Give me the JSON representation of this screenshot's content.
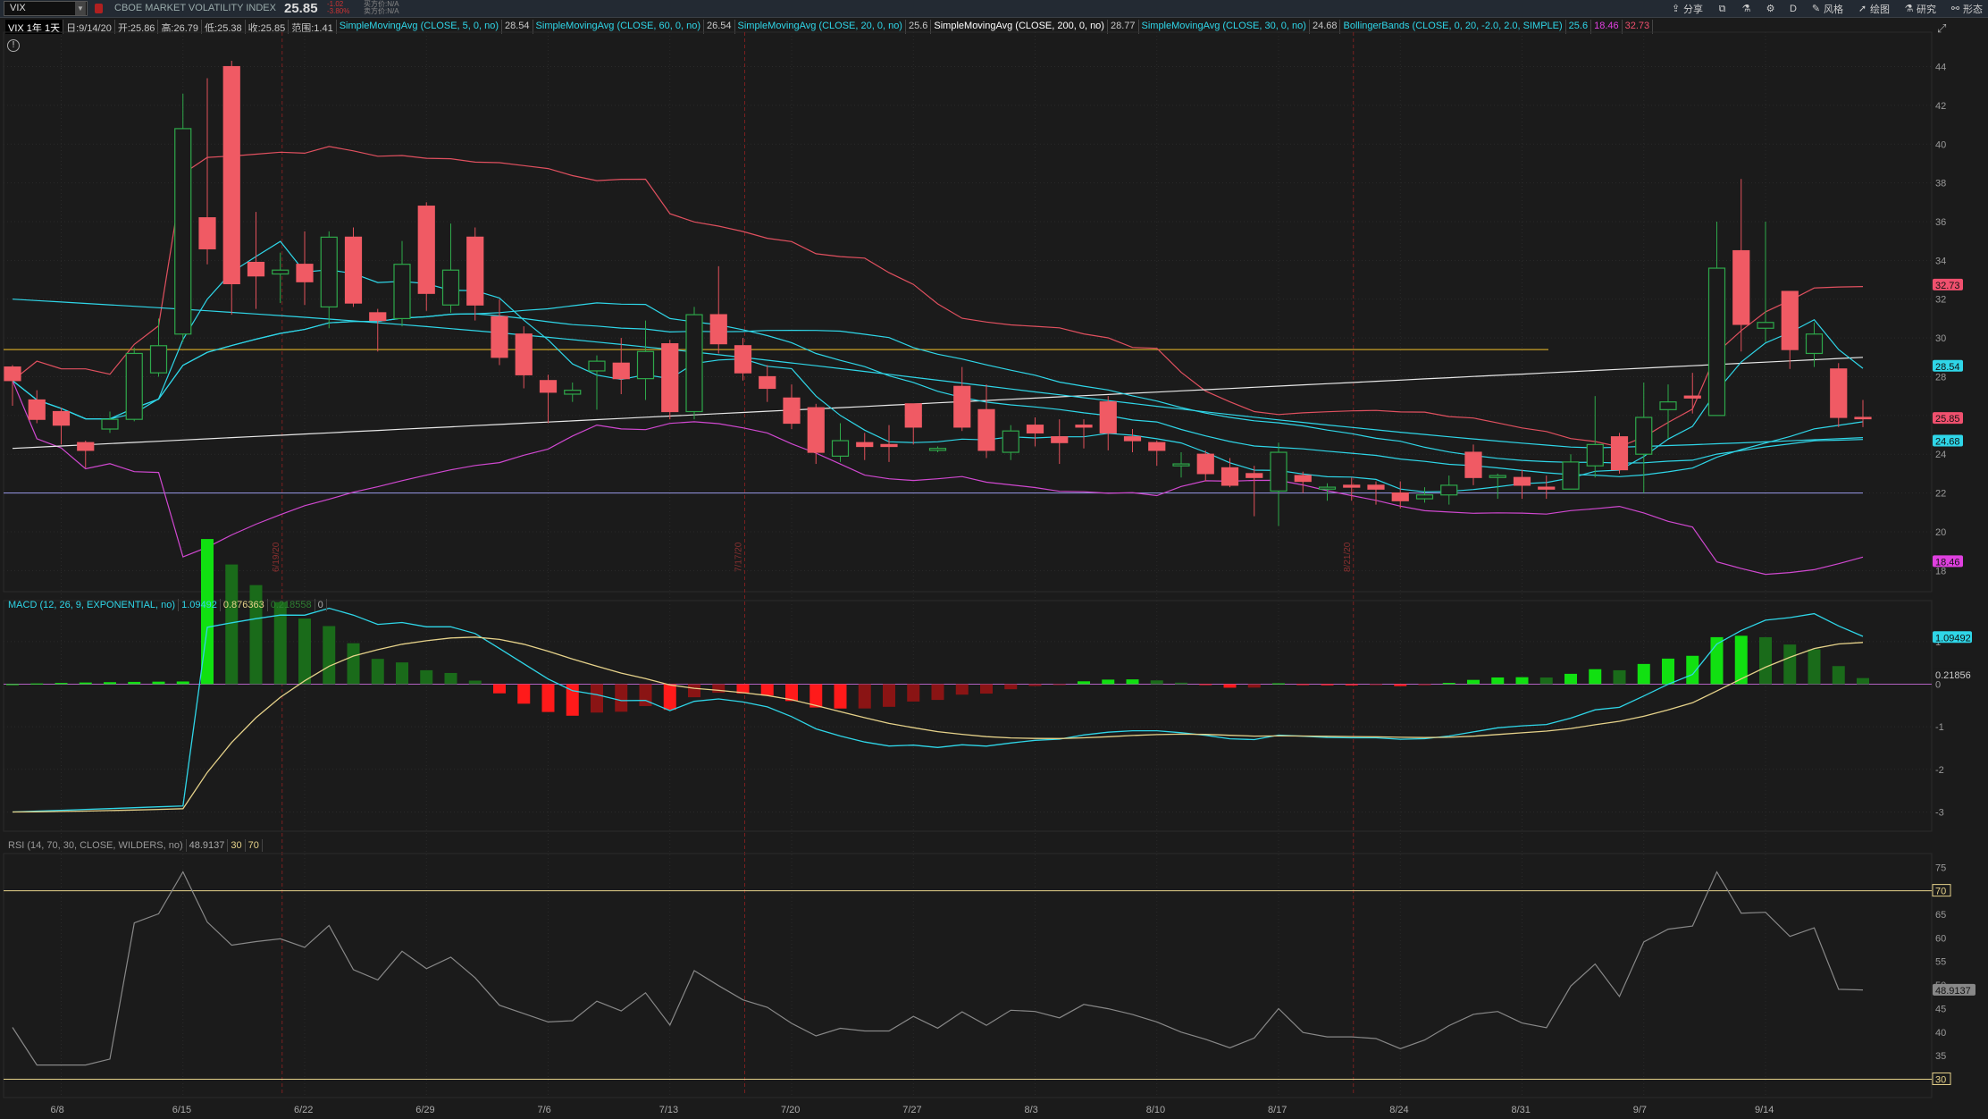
{
  "topbar": {
    "symbol": "VIX",
    "name": "CBOE MARKET VOLATILITY INDEX",
    "price": "25.85",
    "change": "-1.02",
    "change_pct": "-3.80%",
    "bid": "买方价:N/A",
    "ask": "卖方价:N/A",
    "tools": [
      {
        "label": "分享",
        "icon": "share-icon"
      },
      {
        "label": "",
        "icon": "compare-icon"
      },
      {
        "label": "",
        "icon": "flask-icon"
      },
      {
        "label": "",
        "icon": "gear-icon"
      },
      {
        "label": "D",
        "icon": ""
      },
      {
        "label": "风格",
        "icon": "style-icon"
      },
      {
        "label": "绘图",
        "icon": "cursor-icon"
      },
      {
        "label": "研究",
        "icon": "flask-icon"
      },
      {
        "label": "形态",
        "icon": "pattern-icon"
      }
    ]
  },
  "legend": {
    "title": "VIX 1年 1天",
    "date": "日:9/14/20",
    "open": "开:25.86",
    "high": "高:26.79",
    "low": "低:25.38",
    "close": "收:25.85",
    "range": "范围:1.41",
    "studies": [
      {
        "name": "SimpleMovingAvg (CLOSE, 5, 0, no)",
        "value": "28.54",
        "color": "#2fd6e8"
      },
      {
        "name": "SimpleMovingAvg (CLOSE, 60, 0, no)",
        "value": "26.54",
        "color": "#2fd6e8"
      },
      {
        "name": "SimpleMovingAvg (CLOSE, 20, 0, no)",
        "value": "25.6",
        "color": "#2fd6e8"
      },
      {
        "name": "SimpleMovingAvg (CLOSE, 200, 0, no)",
        "value": "28.77",
        "color": "#ffffff"
      },
      {
        "name": "SimpleMovingAvg (CLOSE, 30, 0, no)",
        "value": "24.68",
        "color": "#2fd6e8"
      },
      {
        "name": "BollingerBands (CLOSE, 0, 20, -2.0, 2.0, SIMPLE)",
        "value": "25.6",
        "value2": "18.46",
        "value3": "32.73",
        "color": "#2fd6e8"
      }
    ]
  },
  "price_panel": {
    "y_ticks": [
      "44",
      "42",
      "40",
      "38",
      "36",
      "34",
      "32",
      "30",
      "28",
      "26",
      "24",
      "22",
      "20",
      "18"
    ],
    "ylim": [
      17,
      45.5
    ],
    "badges": [
      {
        "value": "32.73",
        "color": "#f0506e"
      },
      {
        "value": "28.54",
        "color": "#2fd6e8"
      },
      {
        "value": "25.85",
        "color": "#f0506e"
      },
      {
        "value": "24.68",
        "color": "#2fd6e8"
      },
      {
        "value": "18.46",
        "color": "#e040e0"
      }
    ],
    "vlines": [
      "6/19/20",
      "7/17/20",
      "8/21/20"
    ]
  },
  "macd": {
    "legend": "MACD (12, 26, 9, EXPONENTIAL, no)",
    "value": "1.09492",
    "avg": "0.876363",
    "diff": "0.218558",
    "zero": "0",
    "y_ticks": [
      "1",
      "0",
      "-1",
      "-2",
      "-3"
    ],
    "badge_value": "1.09492",
    "badge_diff": "0.21856"
  },
  "rsi": {
    "legend": "RSI (14, 70, 30, CLOSE, WILDERS, no)",
    "value": "48.9137",
    "os": "30",
    "ob": "70",
    "y_ticks": [
      "75",
      "70",
      "65",
      "60",
      "55",
      "50",
      "45",
      "40",
      "35",
      "30"
    ],
    "badge_value": "48.9137"
  },
  "xaxis": [
    "6/8",
    "6/15",
    "6/22",
    "6/29",
    "7/6",
    "7/13",
    "7/20",
    "7/27",
    "8/3",
    "8/10",
    "8/17",
    "8/24",
    "8/31",
    "9/7",
    "9/14"
  ],
  "chart_data": {
    "type": "candlestick",
    "ohlc": [
      [
        28.5,
        27.8,
        26.5,
        28.6
      ],
      [
        26.8,
        25.8,
        25.6,
        27.3
      ],
      [
        26.2,
        25.5,
        24.5,
        26.4
      ],
      [
        24.6,
        24.2,
        23.3,
        24.7
      ],
      [
        25.3,
        25.8,
        25.1,
        26.2
      ],
      [
        25.8,
        29.2,
        25.7,
        29.5
      ],
      [
        28.2,
        29.6,
        28.0,
        31.0
      ],
      [
        30.2,
        40.8,
        29.8,
        42.6
      ],
      [
        36.2,
        34.6,
        33.8,
        43.4
      ],
      [
        44.0,
        32.8,
        31.2,
        44.3
      ],
      [
        33.9,
        33.2,
        31.5,
        36.5
      ],
      [
        33.3,
        33.5,
        31.8,
        34.4
      ],
      [
        33.8,
        32.9,
        31.7,
        35.5
      ],
      [
        31.6,
        35.2,
        30.5,
        35.5
      ],
      [
        35.2,
        31.8,
        31.6,
        35.7
      ],
      [
        31.3,
        30.9,
        29.3,
        31.5
      ],
      [
        31.0,
        33.8,
        30.6,
        35.0
      ],
      [
        36.8,
        32.3,
        31.4,
        37.0
      ],
      [
        31.7,
        33.5,
        31.3,
        35.9
      ],
      [
        35.2,
        31.7,
        30.9,
        35.7
      ],
      [
        31.1,
        29.0,
        28.6,
        32.0
      ],
      [
        30.2,
        28.1,
        27.4,
        30.6
      ],
      [
        27.8,
        27.2,
        25.6,
        28.1
      ],
      [
        27.1,
        27.3,
        26.7,
        27.7
      ],
      [
        28.3,
        28.8,
        26.3,
        29.1
      ],
      [
        28.7,
        27.9,
        27.1,
        30.0
      ],
      [
        27.9,
        29.3,
        26.8,
        30.9
      ],
      [
        29.7,
        26.2,
        25.8,
        29.9
      ],
      [
        26.2,
        31.2,
        25.8,
        31.6
      ],
      [
        31.2,
        29.7,
        29.2,
        33.7
      ],
      [
        29.6,
        28.2,
        27.8,
        30.0
      ],
      [
        28.0,
        27.4,
        26.7,
        28.6
      ],
      [
        26.9,
        25.6,
        25.3,
        27.6
      ],
      [
        26.4,
        24.1,
        23.5,
        26.6
      ],
      [
        23.9,
        24.7,
        23.6,
        25.6
      ],
      [
        24.6,
        24.4,
        23.7,
        25.1
      ],
      [
        24.5,
        24.4,
        23.6,
        25.5
      ],
      [
        26.6,
        25.4,
        24.5,
        26.6
      ],
      [
        24.2,
        24.3,
        24.1,
        24.4
      ],
      [
        27.5,
        25.4,
        25.2,
        28.5
      ],
      [
        26.3,
        24.2,
        23.8,
        27.6
      ],
      [
        24.1,
        25.2,
        23.7,
        25.5
      ],
      [
        25.5,
        25.1,
        24.4,
        25.9
      ],
      [
        24.9,
        24.6,
        23.5,
        25.8
      ],
      [
        25.5,
        25.4,
        24.3,
        25.8
      ],
      [
        26.7,
        25.1,
        24.2,
        27.0
      ],
      [
        24.9,
        24.7,
        24.1,
        25.3
      ],
      [
        24.6,
        24.2,
        23.4,
        24.7
      ],
      [
        23.4,
        23.5,
        22.8,
        24.1
      ],
      [
        24.0,
        23.0,
        22.6,
        24.2
      ],
      [
        23.3,
        22.4,
        22.3,
        23.8
      ],
      [
        23.0,
        22.8,
        20.8,
        23.4
      ],
      [
        22.1,
        24.1,
        20.3,
        24.6
      ],
      [
        22.9,
        22.6,
        22.0,
        23.1
      ],
      [
        22.2,
        22.3,
        21.6,
        22.5
      ],
      [
        22.4,
        22.3,
        21.6,
        22.8
      ],
      [
        22.4,
        22.2,
        21.4,
        22.6
      ],
      [
        22.0,
        21.6,
        21.2,
        22.6
      ],
      [
        21.7,
        21.9,
        21.5,
        22.3
      ],
      [
        21.9,
        22.4,
        21.4,
        22.9
      ],
      [
        24.1,
        22.8,
        22.4,
        24.5
      ],
      [
        22.8,
        22.9,
        21.7,
        23.0
      ],
      [
        22.8,
        22.4,
        21.7,
        23.2
      ],
      [
        22.3,
        22.2,
        21.7,
        22.9
      ],
      [
        22.2,
        23.6,
        22.3,
        24.0
      ],
      [
        23.4,
        24.5,
        22.8,
        27.0
      ],
      [
        24.9,
        23.2,
        23.0,
        25.1
      ],
      [
        24.0,
        25.9,
        22.0,
        27.7
      ],
      [
        26.3,
        26.7,
        24.8,
        27.6
      ],
      [
        27.0,
        26.9,
        26.1,
        28.2
      ],
      [
        26.0,
        33.6,
        26.0,
        36.0
      ],
      [
        34.5,
        30.7,
        29.3,
        38.2
      ],
      [
        30.5,
        30.8,
        29.8,
        36.0
      ],
      [
        32.4,
        29.4,
        28.4,
        32.4
      ],
      [
        29.2,
        30.2,
        28.5,
        30.8
      ],
      [
        28.4,
        25.9,
        25.4,
        28.7
      ],
      [
        25.9,
        25.85,
        25.4,
        26.8
      ]
    ]
  }
}
